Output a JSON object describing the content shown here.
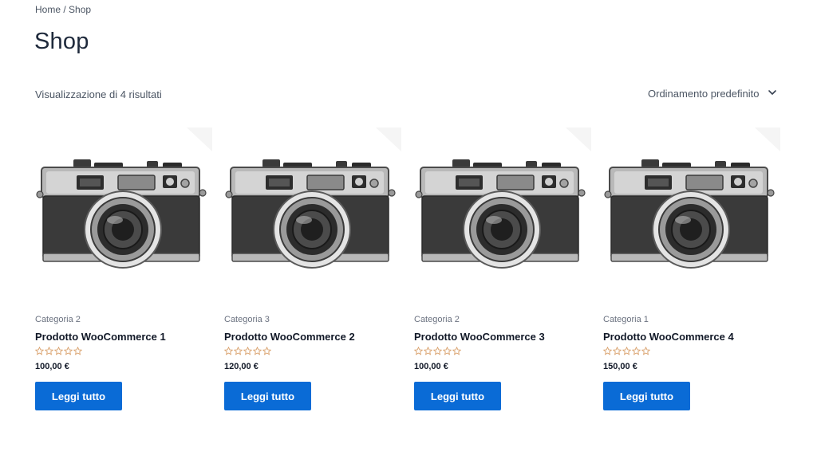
{
  "breadcrumb": {
    "home": "Home",
    "separator": " / ",
    "current": "Shop"
  },
  "page": {
    "title": "Shop"
  },
  "results": {
    "count_text": "Visualizzazione di 4 risultati"
  },
  "ordering": {
    "selected": "Ordinamento predefinito",
    "icon": "chevron-down-icon"
  },
  "colors": {
    "button": "#0a6bd6",
    "star_outline": "#d9a06b"
  },
  "products": [
    {
      "category": "Categoria 2",
      "name": "Prodotto WooCommerce 1",
      "price": "100,00 €",
      "button": "Leggi tutto",
      "rating": 0
    },
    {
      "category": "Categoria 3",
      "name": "Prodotto WooCommerce 2",
      "price": "120,00 €",
      "button": "Leggi tutto",
      "rating": 0
    },
    {
      "category": "Categoria 2",
      "name": "Prodotto WooCommerce 3",
      "price": "100,00 €",
      "button": "Leggi tutto",
      "rating": 0
    },
    {
      "category": "Categoria 1",
      "name": "Prodotto WooCommerce 4",
      "price": "150,00 €",
      "button": "Leggi tutto",
      "rating": 0
    }
  ]
}
